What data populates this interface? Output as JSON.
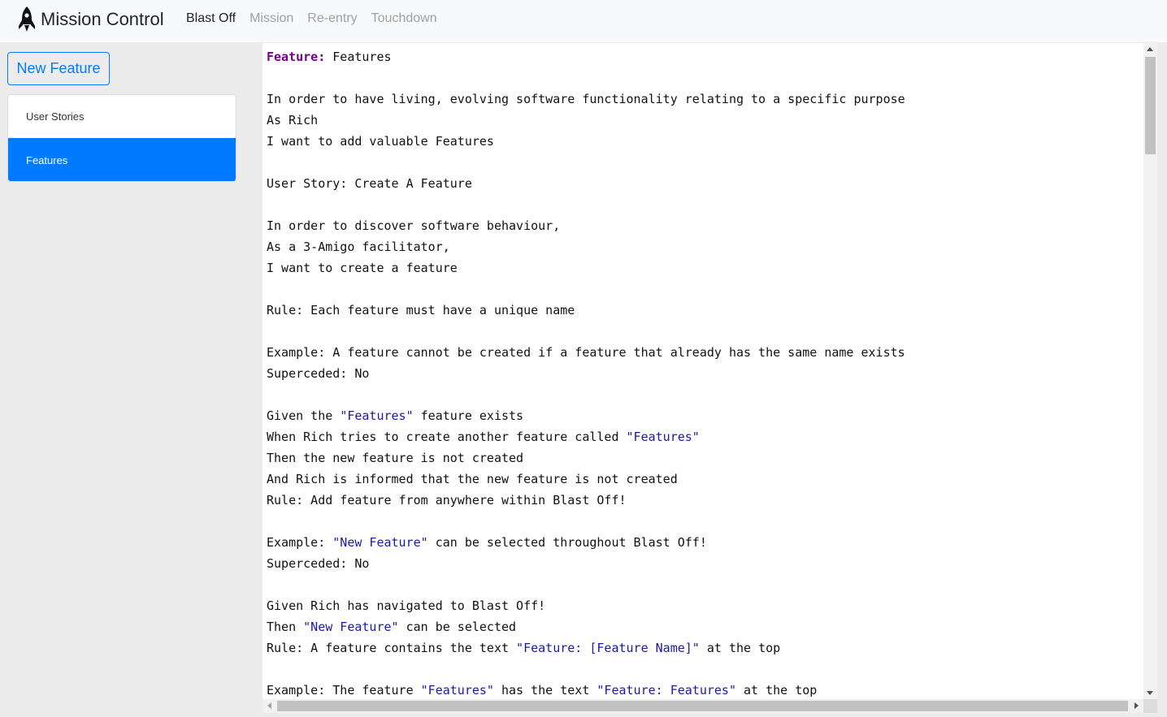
{
  "brand": {
    "name": "Mission Control",
    "icon": "rocket-icon"
  },
  "nav": [
    {
      "label": "Blast Off",
      "active": true
    },
    {
      "label": "Mission",
      "active": false
    },
    {
      "label": "Re-entry",
      "active": false
    },
    {
      "label": "Touchdown",
      "active": false
    }
  ],
  "sidebar": {
    "new_feature_label": "New Feature",
    "items": [
      {
        "label": "User Stories",
        "active": false
      },
      {
        "label": "Features",
        "active": true
      }
    ]
  },
  "colors": {
    "accent": "#007bff",
    "keyword": "#770088",
    "string": "#1a1aa6",
    "nav_inactive": "#a0a0a0"
  },
  "editor": {
    "lines": [
      [
        {
          "t": "Feature:",
          "s": "kw"
        },
        {
          "t": " Features"
        }
      ],
      [],
      [
        {
          "t": "In order to have living, evolving software functionality relating to a specific purpose"
        }
      ],
      [
        {
          "t": "As Rich"
        }
      ],
      [
        {
          "t": "I want to add valuable Features"
        }
      ],
      [],
      [
        {
          "t": "User Story: Create A Feature"
        }
      ],
      [],
      [
        {
          "t": "In order to discover software behaviour,"
        }
      ],
      [
        {
          "t": "As a 3-Amigo facilitator,"
        }
      ],
      [
        {
          "t": "I want to create a feature"
        }
      ],
      [],
      [
        {
          "t": "Rule: Each feature must have a unique name"
        }
      ],
      [],
      [
        {
          "t": "Example: A feature cannot be created if a feature that already has the same name exists"
        }
      ],
      [
        {
          "t": "Superceded: No"
        }
      ],
      [],
      [
        {
          "t": "Given the "
        },
        {
          "t": "\"Features\"",
          "s": "str"
        },
        {
          "t": " feature exists"
        }
      ],
      [
        {
          "t": "When Rich tries to create another feature called "
        },
        {
          "t": "\"Features\"",
          "s": "str"
        }
      ],
      [
        {
          "t": "Then the new feature is not created"
        }
      ],
      [
        {
          "t": "And Rich is informed that the new feature is not created"
        }
      ],
      [
        {
          "t": "Rule: Add feature from anywhere within Blast Off!"
        }
      ],
      [],
      [
        {
          "t": "Example: "
        },
        {
          "t": "\"New Feature\"",
          "s": "str"
        },
        {
          "t": " can be selected throughout Blast Off!"
        }
      ],
      [
        {
          "t": "Superceded: No"
        }
      ],
      [],
      [
        {
          "t": "Given Rich has navigated to Blast Off!"
        }
      ],
      [
        {
          "t": "Then "
        },
        {
          "t": "\"New Feature\"",
          "s": "str"
        },
        {
          "t": " can be selected"
        }
      ],
      [
        {
          "t": "Rule: A feature contains the text "
        },
        {
          "t": "\"Feature: [Feature Name]\"",
          "s": "str"
        },
        {
          "t": " at the top"
        }
      ],
      [],
      [
        {
          "t": "Example: The feature "
        },
        {
          "t": "\"Features\"",
          "s": "str"
        },
        {
          "t": " has the text "
        },
        {
          "t": "\"Feature: Features\"",
          "s": "str"
        },
        {
          "t": " at the top"
        }
      ]
    ]
  }
}
